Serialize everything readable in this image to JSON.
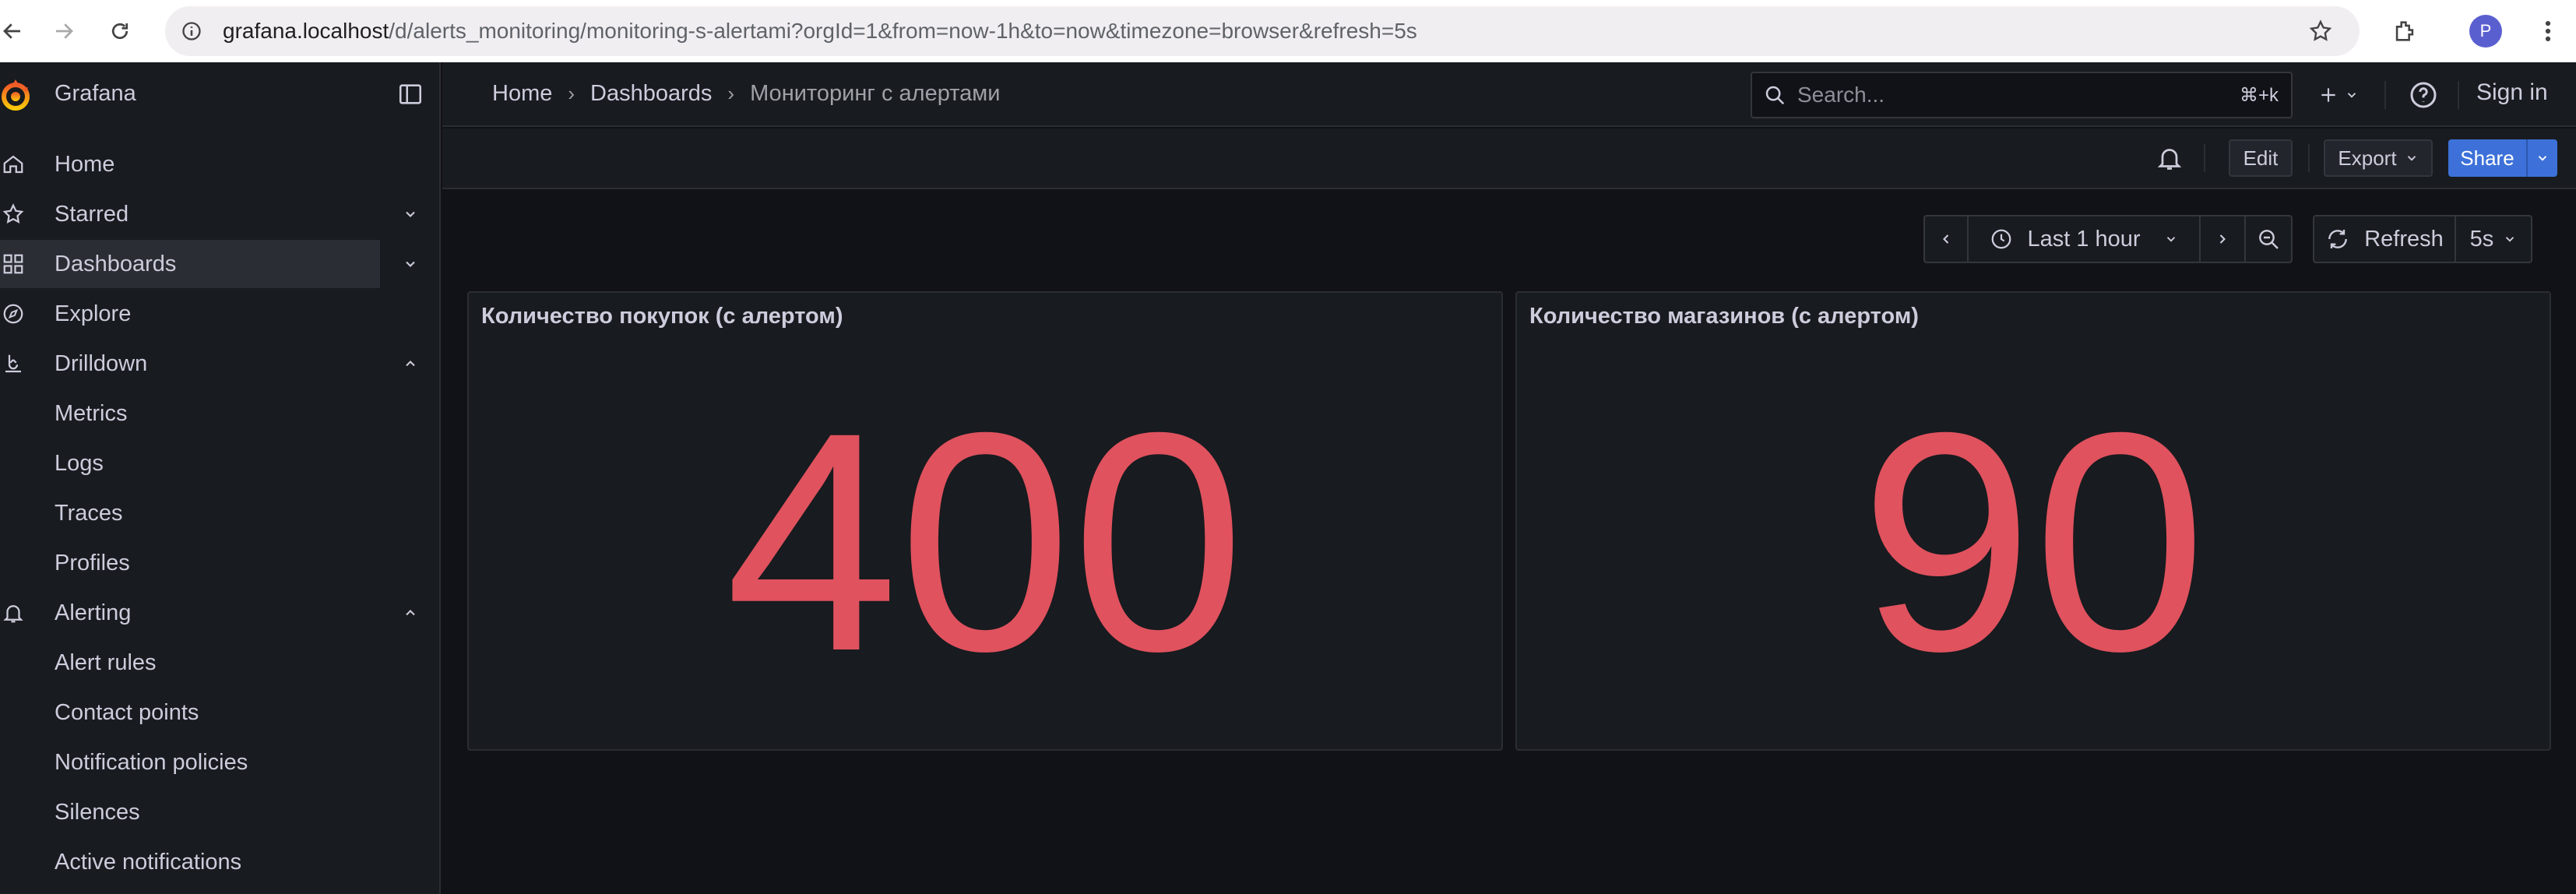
{
  "browser": {
    "url_host": "grafana.localhost",
    "url_path": "/d/alerts_monitoring/monitoring-s-alertami?orgId=1&from=now-1h&to=now&timezone=browser&refresh=5s",
    "avatar_letter": "P"
  },
  "app": {
    "brand": "Grafana",
    "accent_color": "#e0525e",
    "primary_color": "#3d71d9"
  },
  "sidebar": {
    "items": [
      {
        "label": "Home"
      },
      {
        "label": "Starred"
      },
      {
        "label": "Dashboards"
      },
      {
        "label": "Explore"
      },
      {
        "label": "Drilldown"
      },
      {
        "label": "Metrics"
      },
      {
        "label": "Logs"
      },
      {
        "label": "Traces"
      },
      {
        "label": "Profiles"
      },
      {
        "label": "Alerting"
      },
      {
        "label": "Alert rules"
      },
      {
        "label": "Contact points"
      },
      {
        "label": "Notification policies"
      },
      {
        "label": "Silences"
      },
      {
        "label": "Active notifications"
      }
    ]
  },
  "header": {
    "breadcrumb": [
      "Home",
      "Dashboards",
      "Мониторинг с алертами"
    ],
    "search_placeholder": "Search...",
    "search_shortcut": "⌘+k",
    "sign_in": "Sign in"
  },
  "toolbar": {
    "edit": "Edit",
    "export": "Export",
    "share": "Share"
  },
  "time": {
    "range": "Last 1 hour",
    "refresh": "Refresh",
    "interval": "5s"
  },
  "panels": [
    {
      "title": "Количество покупок (с алертом)",
      "value": "400"
    },
    {
      "title": "Количество магазинов (с алертом)",
      "value": "90"
    }
  ]
}
